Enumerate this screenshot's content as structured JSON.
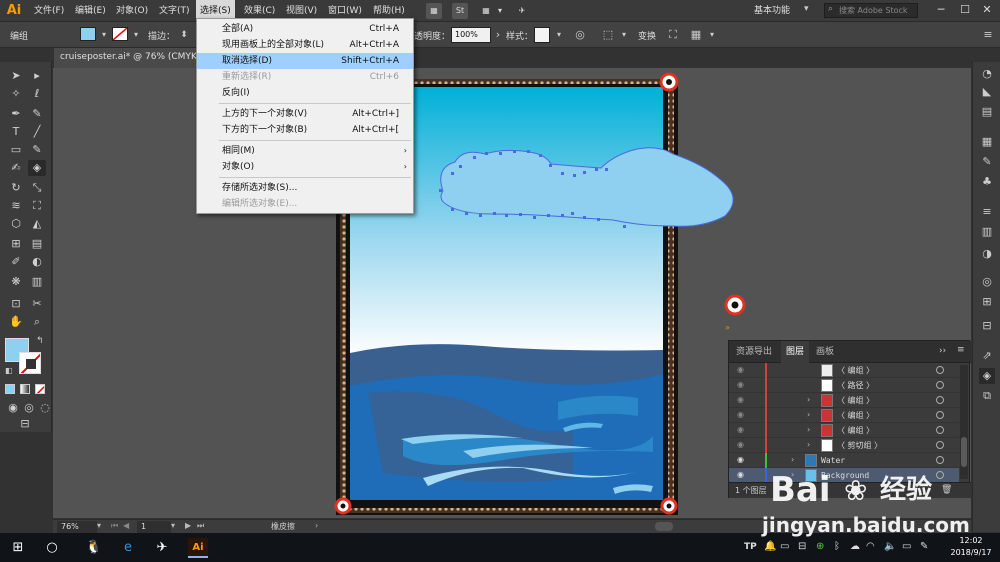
{
  "app": {
    "logo": "Ai"
  },
  "menubar": {
    "items": [
      "文件(F)",
      "编辑(E)",
      "对象(O)",
      "文字(T)",
      "选择(S)",
      "效果(C)",
      "视图(V)",
      "窗口(W)",
      "帮助(H)"
    ],
    "icon_st": "St",
    "workspace": "基本功能",
    "search_placeholder": "搜索 Adobe Stock"
  },
  "controlbar": {
    "selection_label": "编组",
    "stroke_label": "描边：",
    "opacity_label": "透明度：",
    "opacity_value": "100%",
    "style_label": "样式：",
    "transform_label": "变换"
  },
  "document": {
    "tab_title": "cruiseposter.ai* @ 76% (CMYK/"
  },
  "select_menu": {
    "items": [
      {
        "label": "全部(A)",
        "shortcut": "Ctrl+A"
      },
      {
        "label": "现用画板上的全部对象(L)",
        "shortcut": "Alt+Ctrl+A"
      },
      {
        "label": "取消选择(D)",
        "shortcut": "Shift+Ctrl+A"
      },
      {
        "label": "重新选择(R)",
        "shortcut": "Ctrl+6"
      },
      {
        "label": "反向(I)",
        "shortcut": ""
      },
      {
        "label": "上方的下一个对象(V)",
        "shortcut": "Alt+Ctrl+]"
      },
      {
        "label": "下方的下一个对象(B)",
        "shortcut": "Alt+Ctrl+["
      },
      {
        "label": "相同(M)",
        "shortcut": ""
      },
      {
        "label": "对象(O)",
        "shortcut": ""
      },
      {
        "label": "存储所选对象(S)...",
        "shortcut": ""
      },
      {
        "label": "编辑所选对象(E)...",
        "shortcut": ""
      }
    ]
  },
  "layers_panel": {
    "tabs": [
      "资源导出",
      "图层",
      "画板"
    ],
    "rows": [
      {
        "name": "〈 编组 〉"
      },
      {
        "name": "〈 路径 〉"
      },
      {
        "name": "〈 编组 〉"
      },
      {
        "name": "〈 编组 〉"
      },
      {
        "name": "〈 编组 〉"
      },
      {
        "name": "〈 剪切组 〉"
      },
      {
        "name": "Water"
      },
      {
        "name": "Background"
      }
    ],
    "footer_count": "1 个图层"
  },
  "statusbar": {
    "zoom": "76%",
    "artboard": "1",
    "tool": "橡皮擦"
  },
  "taskbar": {
    "time": "12:02",
    "date": "2018/9/17"
  },
  "watermark": {
    "brand": "Bai",
    "brand_suffix": "经验",
    "url": "jingyan.baidu.com"
  },
  "colors": {
    "fill_swatch": "#8fd0f0",
    "sky_top": "#00b0d8",
    "sea_dark": "#3a6090",
    "accent_orange": "#ff9a00",
    "menu_highlight": "#9fcfff"
  }
}
